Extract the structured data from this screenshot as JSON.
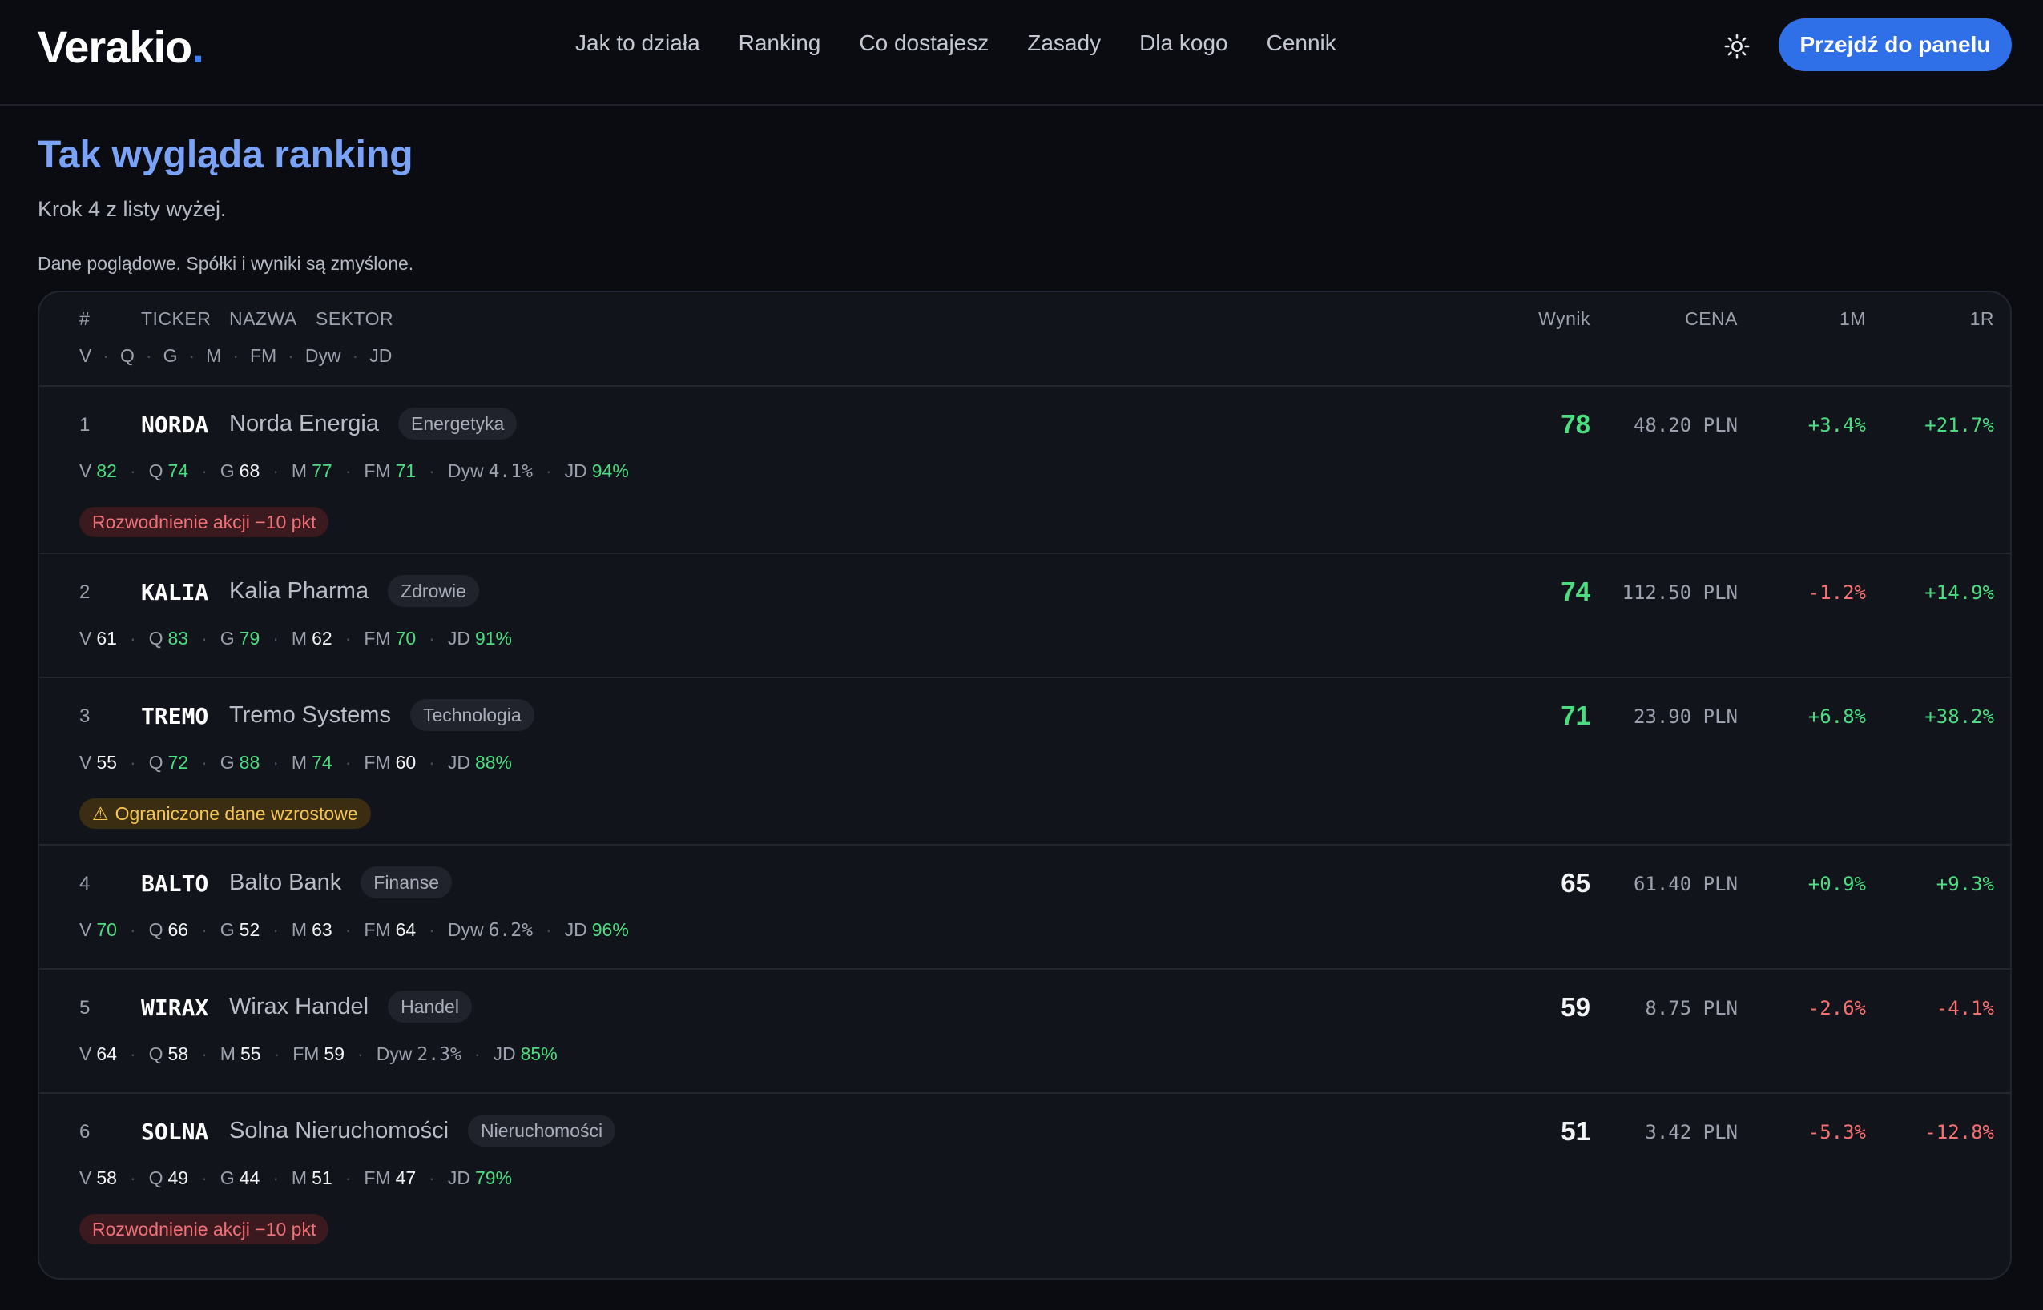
{
  "brand": {
    "name": "Verakio",
    "dot": "."
  },
  "nav": {
    "links": [
      "Jak to działa",
      "Ranking",
      "Co dostajesz",
      "Zasady",
      "Dla kogo",
      "Cennik"
    ],
    "cta": "Przejdź do panelu"
  },
  "section": {
    "title": "Tak wygląda ranking",
    "subtitle": "Krok 4 z listy wyżej.",
    "note": "Dane poglądowe. Spółki i wyniki są zmyślone."
  },
  "table": {
    "headers": {
      "rank": "#",
      "ticker": "TICKER",
      "name": "NAZWA",
      "sector": "SEKTOR",
      "score": "Wynik",
      "price": "CENA",
      "m1": "1M",
      "r1": "1R"
    },
    "sub_headers": [
      "V",
      "Q",
      "G",
      "M",
      "FM",
      "Dyw",
      "JD"
    ],
    "rows": [
      {
        "rank": "1",
        "ticker": "NORDA",
        "name": "Norda Energia",
        "sector": "Energetyka",
        "score": "78",
        "price": "48.20 PLN",
        "m1": "+3.4%",
        "r1": "+21.7%",
        "metrics": [
          {
            "k": "V",
            "v": "82",
            "c": "green"
          },
          {
            "k": "Q",
            "v": "74",
            "c": "green"
          },
          {
            "k": "G",
            "v": "68",
            "c": "white"
          },
          {
            "k": "M",
            "v": "77",
            "c": "green"
          },
          {
            "k": "FM",
            "v": "71",
            "c": "green"
          },
          {
            "k": "Dyw",
            "v": "4.1%",
            "c": "mono"
          },
          {
            "k": "JD",
            "v": "94%",
            "c": "green"
          }
        ],
        "badge": {
          "text": "Rozwodnienie akcji −10 pkt",
          "type": "red"
        }
      },
      {
        "rank": "2",
        "ticker": "KALIA",
        "name": "Kalia Pharma",
        "sector": "Zdrowie",
        "score": "74",
        "price": "112.50 PLN",
        "m1": "-1.2%",
        "r1": "+14.9%",
        "metrics": [
          {
            "k": "V",
            "v": "61",
            "c": "white"
          },
          {
            "k": "Q",
            "v": "83",
            "c": "green"
          },
          {
            "k": "G",
            "v": "79",
            "c": "green"
          },
          {
            "k": "M",
            "v": "62",
            "c": "white"
          },
          {
            "k": "FM",
            "v": "70",
            "c": "green"
          },
          {
            "k": "JD",
            "v": "91%",
            "c": "green"
          }
        ],
        "badge": null
      },
      {
        "rank": "3",
        "ticker": "TREMO",
        "name": "Tremo Systems",
        "sector": "Technologia",
        "score": "71",
        "price": "23.90 PLN",
        "m1": "+6.8%",
        "r1": "+38.2%",
        "metrics": [
          {
            "k": "V",
            "v": "55",
            "c": "white"
          },
          {
            "k": "Q",
            "v": "72",
            "c": "green"
          },
          {
            "k": "G",
            "v": "88",
            "c": "green"
          },
          {
            "k": "M",
            "v": "74",
            "c": "green"
          },
          {
            "k": "FM",
            "v": "60",
            "c": "white"
          },
          {
            "k": "JD",
            "v": "88%",
            "c": "green"
          }
        ],
        "badge": {
          "text": "Ograniczone dane wzrostowe",
          "type": "amber"
        }
      },
      {
        "rank": "4",
        "ticker": "BALTO",
        "name": "Balto Bank",
        "sector": "Finanse",
        "score": "65",
        "price": "61.40 PLN",
        "m1": "+0.9%",
        "r1": "+9.3%",
        "metrics": [
          {
            "k": "V",
            "v": "70",
            "c": "green"
          },
          {
            "k": "Q",
            "v": "66",
            "c": "white"
          },
          {
            "k": "G",
            "v": "52",
            "c": "white"
          },
          {
            "k": "M",
            "v": "63",
            "c": "white"
          },
          {
            "k": "FM",
            "v": "64",
            "c": "white"
          },
          {
            "k": "Dyw",
            "v": "6.2%",
            "c": "mono"
          },
          {
            "k": "JD",
            "v": "96%",
            "c": "green"
          }
        ],
        "badge": null
      },
      {
        "rank": "5",
        "ticker": "WIRAX",
        "name": "Wirax Handel",
        "sector": "Handel",
        "score": "59",
        "price": "8.75 PLN",
        "m1": "-2.6%",
        "r1": "-4.1%",
        "metrics": [
          {
            "k": "V",
            "v": "64",
            "c": "white"
          },
          {
            "k": "Q",
            "v": "58",
            "c": "white"
          },
          {
            "k": "M",
            "v": "55",
            "c": "white"
          },
          {
            "k": "FM",
            "v": "59",
            "c": "white"
          },
          {
            "k": "Dyw",
            "v": "2.3%",
            "c": "mono"
          },
          {
            "k": "JD",
            "v": "85%",
            "c": "green"
          }
        ],
        "badge": null
      },
      {
        "rank": "6",
        "ticker": "SOLNA",
        "name": "Solna Nieruchomości",
        "sector": "Nieruchomości",
        "score": "51",
        "price": "3.42 PLN",
        "m1": "-5.3%",
        "r1": "-12.8%",
        "metrics": [
          {
            "k": "V",
            "v": "58",
            "c": "white"
          },
          {
            "k": "Q",
            "v": "49",
            "c": "white"
          },
          {
            "k": "G",
            "v": "44",
            "c": "white"
          },
          {
            "k": "M",
            "v": "51",
            "c": "white"
          },
          {
            "k": "FM",
            "v": "47",
            "c": "white"
          },
          {
            "k": "JD",
            "v": "79%",
            "c": "green"
          }
        ],
        "badge": {
          "text": "Rozwodnienie akcji −10 pkt",
          "type": "red"
        }
      }
    ]
  },
  "colors": {
    "accent": "#2f6fe8",
    "title": "#7aa2f7",
    "positive": "#4ade80",
    "negative": "#f87171"
  }
}
